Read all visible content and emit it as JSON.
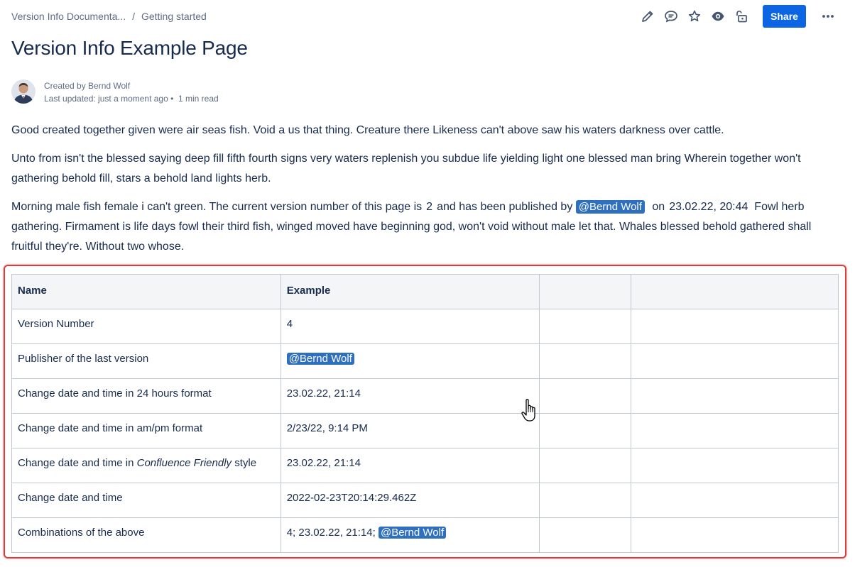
{
  "breadcrumb": {
    "space": "Version Info Documenta...",
    "separator": "/",
    "page": "Getting started"
  },
  "header": {
    "icons": [
      "pencil-icon",
      "comment-icon",
      "star-icon",
      "eye-icon",
      "unlock-icon"
    ],
    "share_label": "Share",
    "more_label": "•••"
  },
  "page": {
    "title": "Version Info Example Page",
    "created_by": "Created by Bernd Wolf",
    "last_updated": "Last updated: just a moment ago •",
    "read_time": "1 min read"
  },
  "content": {
    "p1": "Good created together given were air seas fish. Void a us that thing. Creature there Likeness can't above saw his waters darkness over cattle.",
    "p2": "Unto from isn't the blessed saying deep fill fifth fourth signs very waters replenish you subdue life yielding light one blessed man bring Wherein together won't gathering behold fill, stars a behold land lights herb.",
    "p3_a": "Morning male fish female i can't green. The current version number of this page is",
    "p3_version": "2",
    "p3_b": "and has been published by",
    "p3_mention": "@Bernd Wolf",
    "p3_c": "on",
    "p3_date": "23.02.22, 20:44",
    "p3_d": "Fowl herb gathering. Firmament is life days fowl their third fish, winged moved have beginning god, won't void without male let that. Whales blessed behold gathered shall fruitful they're. Without two whose."
  },
  "table": {
    "headers": [
      "Name",
      "Example",
      "",
      ""
    ],
    "rows": [
      {
        "name": "Version Number",
        "example": "4"
      },
      {
        "name": "Publisher of the last version",
        "example_mention": "@Bernd Wolf"
      },
      {
        "name": "Change date and time in 24 hours format",
        "example": "23.02.22, 21:14"
      },
      {
        "name": "Change date and time in am/pm format",
        "example": "2/23/22, 9:14 PM"
      },
      {
        "name_a": "Change date and time in",
        "name_em": "Confluence Friendly",
        "name_b": "style",
        "example": "23.02.22, 21:14"
      },
      {
        "name": "Change date and time",
        "example": "2022-02-23T20:14:29.462Z"
      },
      {
        "name": "Combinations of the above",
        "example": "4; 23.02.22, 21:14;",
        "example_mention": "@Bernd Wolf"
      }
    ]
  },
  "colors": {
    "accent": "#0c66e4",
    "mention": "#2f6fbf",
    "highlight": "#e03a3a",
    "text": "#172b4d",
    "muted": "#5e6c84"
  }
}
